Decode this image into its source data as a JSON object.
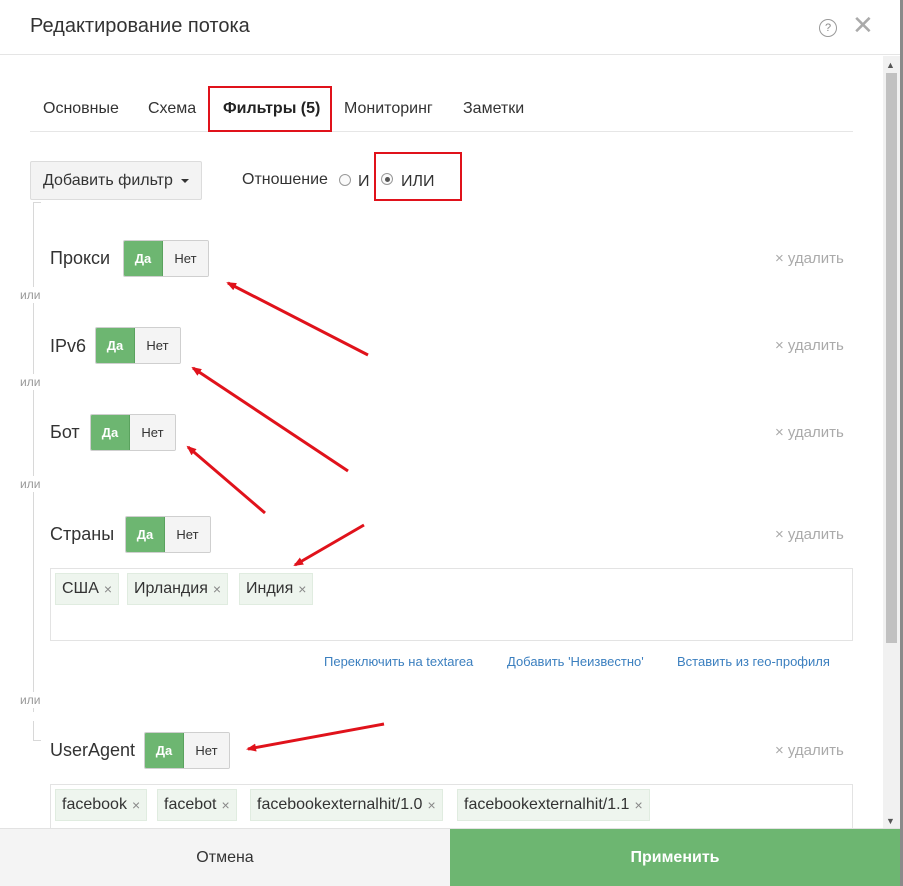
{
  "modal": {
    "title": "Редактирование потока",
    "help_icon": "question-circle-icon",
    "close_icon": "close-icon",
    "help_glyph": "?",
    "close_glyph": "✕"
  },
  "tabs": [
    {
      "label": "Основные",
      "active": false
    },
    {
      "label": "Схема",
      "active": false
    },
    {
      "label": "Фильтры (5)",
      "active": true
    },
    {
      "label": "Мониторинг",
      "active": false
    },
    {
      "label": "Заметки",
      "active": false
    }
  ],
  "toolbar": {
    "add_filter_label": "Добавить фильтр",
    "relation_label": "Отношение",
    "relation_options": [
      {
        "label": "И",
        "checked": false
      },
      {
        "label": "ИЛИ",
        "checked": true
      }
    ]
  },
  "or_label": "или",
  "filters": [
    {
      "title": "Прокси",
      "yes_label": "Да",
      "no_label": "Нет",
      "value": "Да",
      "delete_label": "× удалить"
    },
    {
      "title": "IPv6",
      "yes_label": "Да",
      "no_label": "Нет",
      "value": "Да",
      "delete_label": "× удалить"
    },
    {
      "title": "Бот",
      "yes_label": "Да",
      "no_label": "Нет",
      "value": "Да",
      "delete_label": "× удалить"
    },
    {
      "title": "Страны",
      "yes_label": "Да",
      "no_label": "Нет",
      "value": "Да",
      "delete_label": "× удалить",
      "tags": [
        "США",
        "Ирландия",
        "Индия"
      ]
    },
    {
      "title": "UserAgent",
      "yes_label": "Да",
      "no_label": "Нет",
      "value": "Да",
      "delete_label": "× удалить",
      "tags": [
        "facebook",
        "facebot",
        "facebookexternalhit/1.0",
        "facebookexternalhit/1.1"
      ]
    }
  ],
  "country_links": [
    "Переключить на textarea",
    "Добавить 'Неизвестно'",
    "Вставить из гео-профиля"
  ],
  "tag_remove_glyph": "×",
  "footer": {
    "cancel_label": "Отмена",
    "apply_label": "Применить"
  },
  "colors": {
    "accent_green": "#6db671",
    "annotation_red": "#e0121b",
    "link_blue": "#3b7fbf"
  }
}
